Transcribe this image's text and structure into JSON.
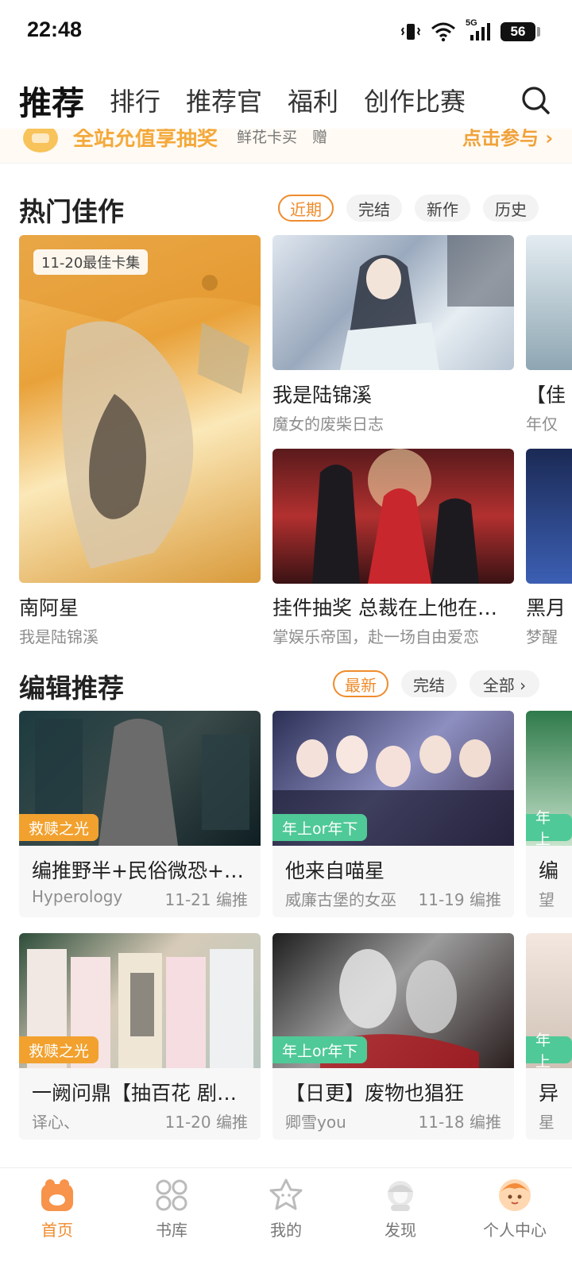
{
  "status": {
    "time": "22:48",
    "network": "5G",
    "battery": "56"
  },
  "nav": {
    "tabs": [
      {
        "label": "推荐",
        "active": true
      },
      {
        "label": "排行",
        "active": false
      },
      {
        "label": "推荐官",
        "active": false
      },
      {
        "label": "福利",
        "active": false
      },
      {
        "label": "创作比赛",
        "active": false
      }
    ],
    "search_icon": "search-icon"
  },
  "banner": {
    "title": "全站允值享抽奖",
    "sub": "鲜花卡买　赠",
    "cta": "点击参与 ›"
  },
  "hot": {
    "title": "热门佳作",
    "chips": [
      {
        "label": "近期",
        "active": true
      },
      {
        "label": "完结",
        "active": false
      },
      {
        "label": "新作",
        "active": false
      },
      {
        "label": "历史",
        "active": false
      }
    ],
    "big": {
      "badge": "11-20最佳卡集",
      "title": "南阿星",
      "sub": "我是陆锦溪"
    },
    "items": [
      {
        "title": "我是陆锦溪",
        "sub": "魔女的废柴日志"
      },
      {
        "title": "挂件抽奖 总裁在上他在…",
        "sub": "掌娱乐帝国，赴一场自由爱恋"
      },
      {
        "title": "【佳",
        "sub": "年仅"
      },
      {
        "title": "黑月",
        "sub": "梦醒"
      }
    ]
  },
  "editor": {
    "title": "编辑推荐",
    "chips": [
      {
        "label": "最新",
        "active": true
      },
      {
        "label": "完结",
        "active": false
      },
      {
        "label": "全部 ›",
        "active": false
      }
    ],
    "cards": [
      {
        "tag": "救赎之光",
        "tag_color": "#f2a12e",
        "title": "编推野半+民俗微恐+…",
        "author": "Hyperology",
        "meta": "11-21 编推"
      },
      {
        "tag": "年上or年下",
        "tag_color": "#4fc997",
        "title": "他来自喵星",
        "author": "威廉古堡的女巫",
        "meta": "11-19 编推"
      },
      {
        "tag": "年上",
        "tag_color": "#4fc997",
        "title": "编",
        "author": "望",
        "meta": ""
      },
      {
        "tag": "救赎之光",
        "tag_color": "#f2a12e",
        "title": "一阙问鼎【抽百花 剧…",
        "author": "译心、",
        "meta": "11-20 编推"
      },
      {
        "tag": "年上or年下",
        "tag_color": "#4fc997",
        "title": "【日更】废物也猖狂",
        "author": "卿雪you",
        "meta": "11-18 编推"
      },
      {
        "tag": "年上",
        "tag_color": "#4fc997",
        "title": "异",
        "author": "星",
        "meta": ""
      }
    ]
  },
  "tabbar": {
    "items": [
      {
        "label": "首页",
        "icon": "home-paw-icon",
        "active": true
      },
      {
        "label": "书库",
        "icon": "library-grid-icon",
        "active": false
      },
      {
        "label": "我的",
        "icon": "star-cat-icon",
        "active": false
      },
      {
        "label": "发现",
        "icon": "discover-avatar-icon",
        "active": false
      },
      {
        "label": "个人中心",
        "icon": "profile-avatar-icon",
        "active": false
      }
    ]
  },
  "colors": {
    "accent": "#ef8b2c",
    "green_tag": "#4fc997",
    "orange_tag": "#f2a12e"
  }
}
